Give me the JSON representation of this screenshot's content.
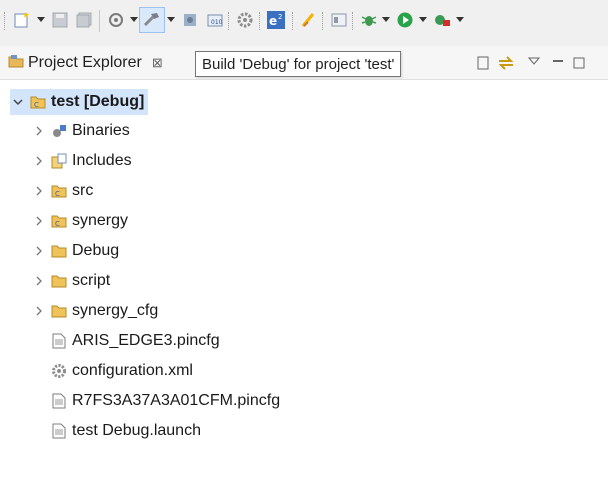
{
  "toolbar": {
    "icons": [
      "new-icon",
      "save-icon",
      "save-all-icon",
      "debug-config-icon",
      "build-hammer-icon",
      "build-config-icon",
      "build-target-icon",
      "settings-gear-icon",
      "e2-studio-icon",
      "brush-icon",
      "properties-icon",
      "debug-bug-icon",
      "run-icon",
      "external-tools-icon"
    ]
  },
  "view": {
    "tab_title": "Project Explorer",
    "close_symbol": "⊠",
    "tooltip": "Build 'Debug' for project 'test'"
  },
  "tree": {
    "root": {
      "label": "test [Debug]",
      "expanded": true
    },
    "items": [
      {
        "label": "Binaries",
        "icon": "binaries-icon",
        "expandable": true
      },
      {
        "label": "Includes",
        "icon": "includes-icon",
        "expandable": true
      },
      {
        "label": "src",
        "icon": "source-folder-icon",
        "expandable": true
      },
      {
        "label": "synergy",
        "icon": "source-folder-icon",
        "expandable": true
      },
      {
        "label": "Debug",
        "icon": "folder-icon",
        "expandable": true
      },
      {
        "label": "script",
        "icon": "folder-icon",
        "expandable": true
      },
      {
        "label": "synergy_cfg",
        "icon": "folder-icon",
        "expandable": true
      },
      {
        "label": "ARIS_EDGE3.pincfg",
        "icon": "file-icon",
        "expandable": false
      },
      {
        "label": "configuration.xml",
        "icon": "config-gear-icon",
        "expandable": false
      },
      {
        "label": "R7FS3A37A3A01CFM.pincfg",
        "icon": "file-icon",
        "expandable": false
      },
      {
        "label": "test Debug.launch",
        "icon": "file-icon",
        "expandable": false
      }
    ]
  }
}
